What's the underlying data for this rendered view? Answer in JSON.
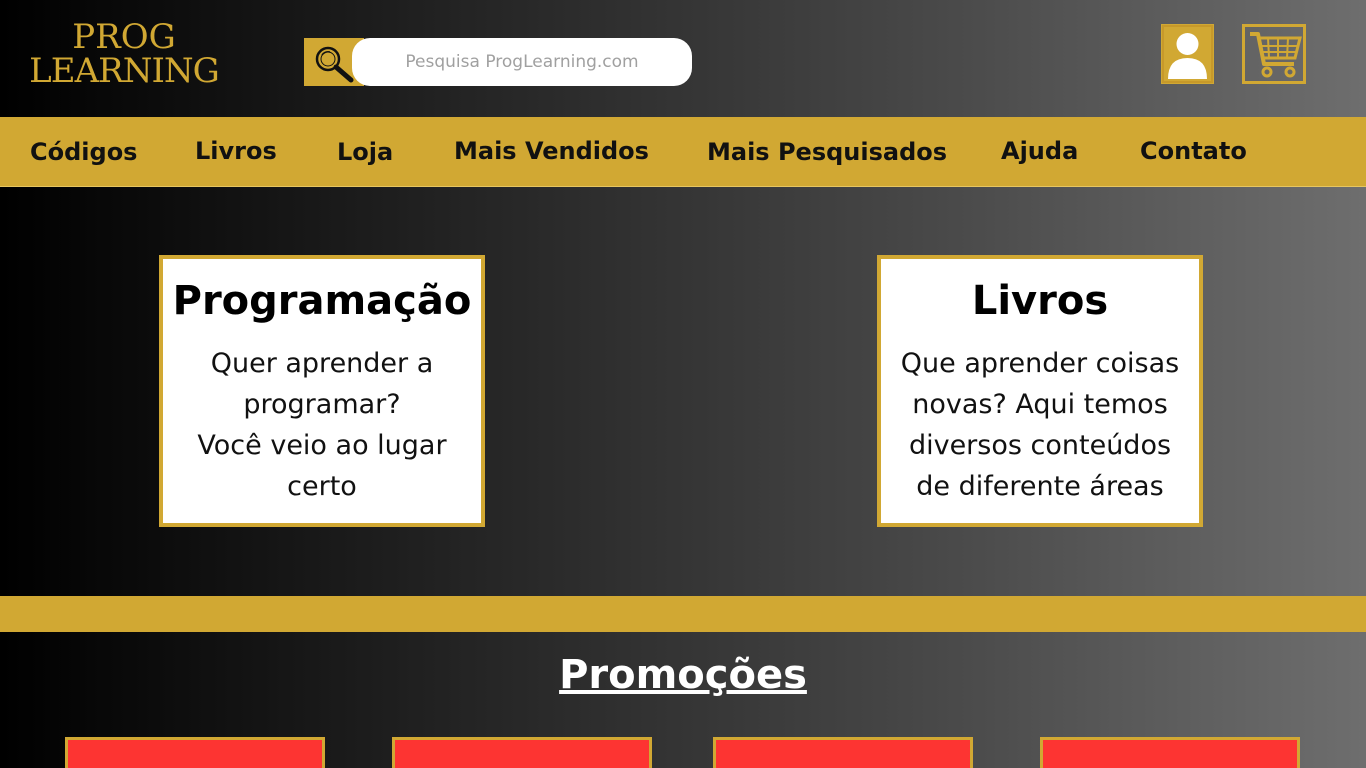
{
  "header": {
    "logo": {
      "line1": "PROG",
      "line2": "LEARNING"
    },
    "search": {
      "placeholder": "Pesquisa ProgLearning.com",
      "icon": "magnifier-icon"
    },
    "icons": {
      "user": "user-icon",
      "cart": "cart-icon"
    }
  },
  "nav": {
    "items": [
      {
        "label": "Códigos"
      },
      {
        "label": "Livros"
      },
      {
        "label": "Loja"
      },
      {
        "label": "Mais Vendidos"
      },
      {
        "label": "Mais Pesquisados"
      },
      {
        "label": "Ajuda"
      },
      {
        "label": "Contato"
      }
    ]
  },
  "cards": [
    {
      "title": "Programação",
      "text": "Quer aprender a\nprogramar?\nVocê veio ao lugar\ncerto"
    },
    {
      "title": "Livros",
      "text": "Que aprender coisas\nnovas? Aqui temos\ndiversos conteúdos\nde diferente áreas"
    }
  ],
  "promo": {
    "title": "Promoções"
  },
  "colors": {
    "gold": "#d1a833",
    "promo_red": "#fd3432",
    "card_bg": "#ffffff"
  }
}
